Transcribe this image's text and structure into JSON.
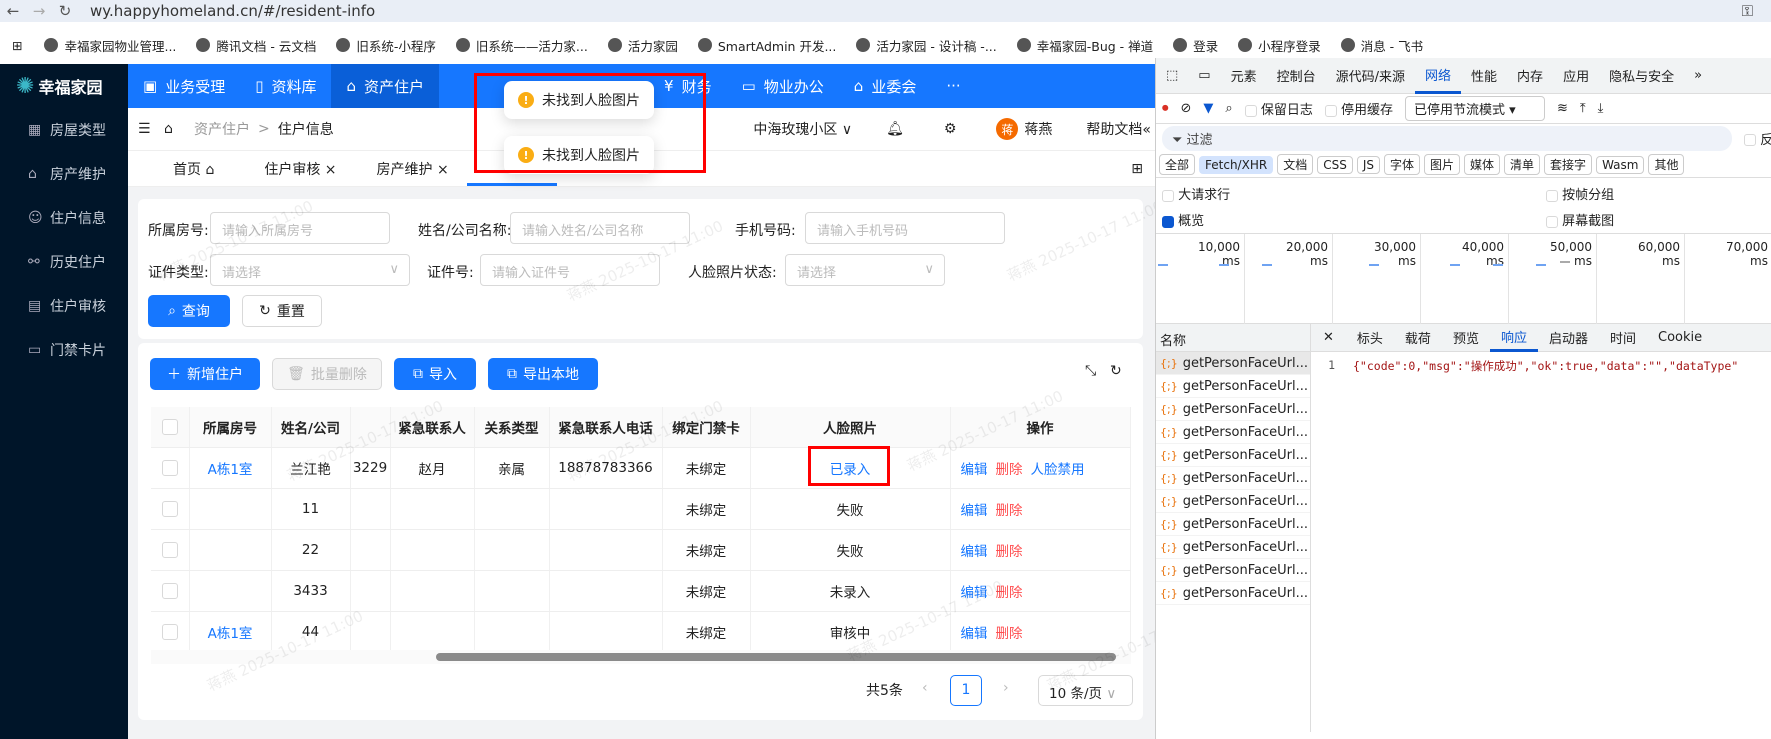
{
  "browser": {
    "url": "wy.happyhomeland.cn/#/resident-info",
    "bookmarks": [
      "幸福家园物业管理...",
      "腾讯文档 - 云文档",
      "旧系统-小程序",
      "旧系统——活力家...",
      "活力家园",
      "SmartAdmin 开发...",
      "活力家园 - 设计稿 -...",
      "幸福家园-Bug - 禅道",
      "登录",
      "小程序登录",
      "消息 - 飞书"
    ]
  },
  "app": {
    "logo": "幸福家园",
    "sidebar": [
      "房屋类型",
      "房产维护",
      "住户信息",
      "历史住户",
      "住户审核",
      "门禁卡片"
    ],
    "topnav": [
      "业务受理",
      "资料库",
      "资产住户",
      "财务",
      "物业办公",
      "业委会",
      "···"
    ],
    "breadcrumb": [
      "资产住户",
      "住户信息"
    ],
    "community": "中海玫瑰小区",
    "user_avatar": "蒋",
    "user": "蒋燕",
    "help": "帮助文档",
    "tabs": [
      "首页",
      "住户审核",
      "房产维护"
    ],
    "toasts": [
      "未找到人脸图片",
      "未找到人脸图片"
    ],
    "watermark": "蒋燕 2025-10-17 11:00",
    "search": {
      "fields": [
        {
          "label": "所属房号:",
          "placeholder": "请输入所属房号"
        },
        {
          "label": "姓名/公司名称:",
          "placeholder": "请输入姓名/公司名称"
        },
        {
          "label": "手机号码:",
          "placeholder": "请输入手机号码"
        },
        {
          "label": "证件类型:",
          "placeholder": "请选择"
        },
        {
          "label": "证件号:",
          "placeholder": "请输入证件号"
        },
        {
          "label": "人脸照片状态:",
          "placeholder": "请选择"
        }
      ],
      "query": "查询",
      "reset": "重置"
    },
    "toolbar": {
      "add": "新增住户",
      "batch_delete": "批量删除",
      "import": "导入",
      "export": "导出本地"
    },
    "table": {
      "columns": [
        "",
        "所属房号",
        "姓名/公司",
        "",
        "紧急联系人",
        "关系类型",
        "紧急联系人电话",
        "绑定门禁卡",
        "人脸照片",
        "操作"
      ],
      "rows": [
        {
          "room": "A栋1室",
          "name": "兰江艳",
          "phone_tail": "3229",
          "contact": "赵月",
          "relation": "亲属",
          "contact_phone": "18878783366",
          "card": "未绑定",
          "face": "已录入",
          "actions": [
            "编辑",
            "删除",
            "人脸禁用"
          ]
        },
        {
          "room": "",
          "name": "11",
          "phone_tail": "",
          "contact": "",
          "relation": "",
          "contact_phone": "",
          "card": "未绑定",
          "face": "失败",
          "actions": [
            "编辑",
            "删除"
          ]
        },
        {
          "room": "",
          "name": "22",
          "phone_tail": "",
          "contact": "",
          "relation": "",
          "contact_phone": "",
          "card": "未绑定",
          "face": "失败",
          "actions": [
            "编辑",
            "删除"
          ]
        },
        {
          "room": "",
          "name": "3433",
          "phone_tail": "",
          "contact": "",
          "relation": "",
          "contact_phone": "",
          "card": "未绑定",
          "face": "未录入",
          "actions": [
            "编辑",
            "删除"
          ]
        },
        {
          "room": "A栋1室",
          "name": "44",
          "phone_tail": "",
          "contact": "",
          "relation": "",
          "contact_phone": "",
          "card": "未绑定",
          "face": "审核中",
          "actions": [
            "编辑",
            "删除"
          ]
        }
      ]
    },
    "pagination": {
      "total": "共5条",
      "page": "1",
      "page_size": "10 条/页"
    }
  },
  "devtools": {
    "tabs": [
      "元素",
      "控制台",
      "源代码/来源",
      "网络",
      "性能",
      "内存",
      "应用",
      "隐私与安全"
    ],
    "preserve_log": "保留日志",
    "disable_cache": "停用缓存",
    "throttle": "已停用节流模式",
    "filter": "过滤",
    "invert": "反转",
    "types": [
      "全部",
      "Fetch/XHR",
      "文档",
      "CSS",
      "JS",
      "字体",
      "图片",
      "媒体",
      "清单",
      "套接字",
      "Wasm",
      "其他"
    ],
    "big_rows": "大请求行",
    "group_frames": "按帧分组",
    "overview": "概览",
    "screenshots": "屏幕截图",
    "timeline": [
      "10,000 ms",
      "20,000 ms",
      "30,000 ms",
      "40,000 ms",
      "50,000 ms",
      "60,000 ms",
      "70,000 ms"
    ],
    "name_header": "名称",
    "request": "getPersonFaceUrl...",
    "detail_tabs": [
      "标头",
      "载荷",
      "预览",
      "响应",
      "启动器",
      "时间",
      "Cookie"
    ],
    "line_no": "1",
    "response": "{\"code\":0,\"msg\":\"操作成功\",\"ok\":true,\"data\":\"\",\"dataType\""
  }
}
